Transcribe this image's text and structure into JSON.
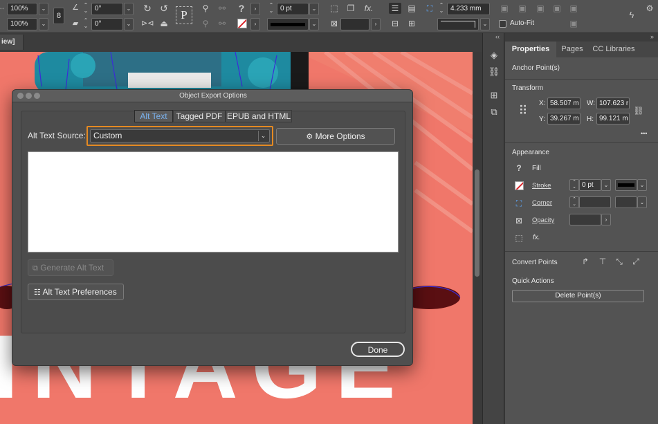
{
  "controlbar": {
    "x_scale": "100%",
    "y_scale": "100%",
    "rotate_angle": "0°",
    "shear_angle": "0°",
    "stroke_weight": "0 pt",
    "corner_size": "4.233 mm",
    "auto_fit_label": "Auto-Fit",
    "p_icon_label": "P",
    "question_mark": "?",
    "fx_label": "fx."
  },
  "document": {
    "tab_label": "iew]"
  },
  "dialog": {
    "title": "Object Export Options",
    "tabs": [
      {
        "label": "Alt Text",
        "active": true
      },
      {
        "label": "Tagged PDF",
        "active": false
      },
      {
        "label": "EPUB and HTML",
        "active": false
      }
    ],
    "alt_text_source_label": "Alt Text Source:",
    "alt_text_source_value": "Custom",
    "more_options_label": "More Options",
    "alt_text_value": "",
    "generate_button_label": "Generate Alt Text",
    "preferences_button_label": "Alt Text Preferences",
    "done_button_label": "Done"
  },
  "panel": {
    "tabs": [
      {
        "label": "Properties",
        "active": true
      },
      {
        "label": "Pages",
        "active": false
      },
      {
        "label": "CC Libraries",
        "active": false
      }
    ],
    "anchor_points_title": "Anchor Point(s)",
    "transform": {
      "title": "Transform",
      "x_label": "X:",
      "x_value": "58.507 m",
      "y_label": "Y:",
      "y_value": "39.267 m",
      "w_label": "W:",
      "w_value": "107.623 r",
      "h_label": "H:",
      "h_value": "99.121 m",
      "more": "•••"
    },
    "appearance": {
      "title": "Appearance",
      "fill_label": "Fill",
      "stroke_label": "Stroke",
      "stroke_weight": "0 pt",
      "corner_label": "Corner",
      "opacity_label": "Opacity",
      "fx_label": "fx."
    },
    "convert_points_title": "Convert Points",
    "quick_actions_title": "Quick Actions",
    "delete_points_label": "Delete Point(s)"
  },
  "colors": {
    "canvas": "#f0776a",
    "accent_blue": "#7ab2ee",
    "focus_orange": "#e58a22",
    "stroke_swatch": "#d9262b"
  }
}
